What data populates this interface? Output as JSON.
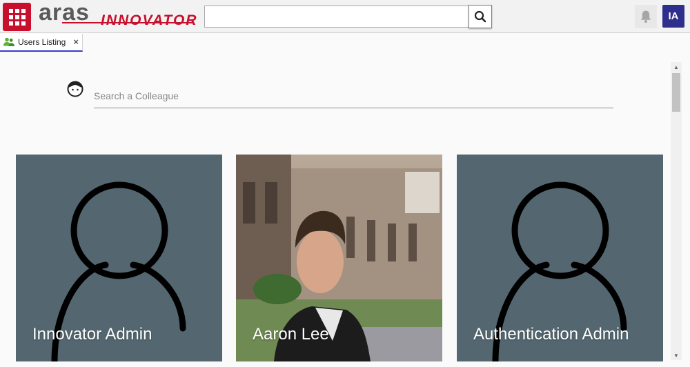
{
  "header": {
    "logo_brand": "aras",
    "logo_product": "INNOVATOR",
    "search_value": "",
    "user_initials": "IA"
  },
  "tabs": [
    {
      "label": "Users Listing",
      "icon": "users-icon"
    }
  ],
  "main": {
    "search_placeholder": "Search a Colleague",
    "cards": [
      {
        "name": "Innovator Admin",
        "image": "default-avatar"
      },
      {
        "name": "Aaron Lee",
        "image": "photo"
      },
      {
        "name": "Authentication Admin",
        "image": "default-avatar"
      }
    ]
  },
  "colors": {
    "brand_red": "#c8102e",
    "card_bg": "#546771",
    "avatar_bg": "#2e2e8c",
    "tab_underline": "#3a3ad0"
  }
}
